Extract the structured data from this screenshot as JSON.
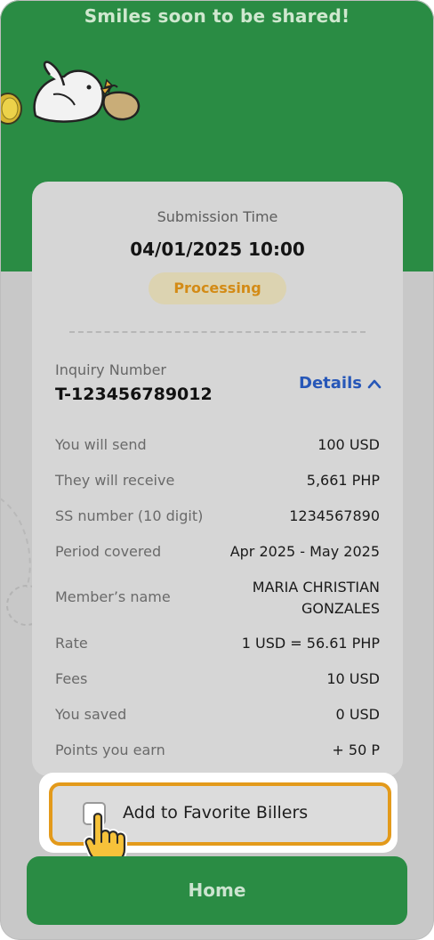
{
  "banner": {
    "headline": "Smiles soon to be shared!"
  },
  "submission": {
    "label": "Submission Time",
    "time": "04/01/2025 10:00",
    "status": "Processing"
  },
  "inquiry": {
    "label": "Inquiry Number",
    "number": "T-123456789012",
    "details_label": "Details"
  },
  "rows": [
    {
      "label": "You will send",
      "value": "100 USD"
    },
    {
      "label": "They will receive",
      "value": "5,661 PHP"
    },
    {
      "label": "SS number (10 digit)",
      "value": "1234567890"
    },
    {
      "label": "Period covered",
      "value": "Apr 2025 - May 2025"
    },
    {
      "label": "Member’s name",
      "value": "MARIA CHRISTIAN",
      "value2": "GONZALES"
    },
    {
      "label": "Rate",
      "value": "1 USD = 56.61 PHP"
    },
    {
      "label": "Fees",
      "value": "10 USD"
    },
    {
      "label": "You saved",
      "value": "0 USD"
    },
    {
      "label": "Points you earn",
      "value": "+ 50 P"
    }
  ],
  "favorite": {
    "label": "Add to Favorite Billers",
    "checked": false
  },
  "home_button": {
    "label": "Home"
  },
  "colors": {
    "brand_green": "#2a8c44",
    "accent_orange": "#e39a1b",
    "link_blue": "#2757b8"
  }
}
